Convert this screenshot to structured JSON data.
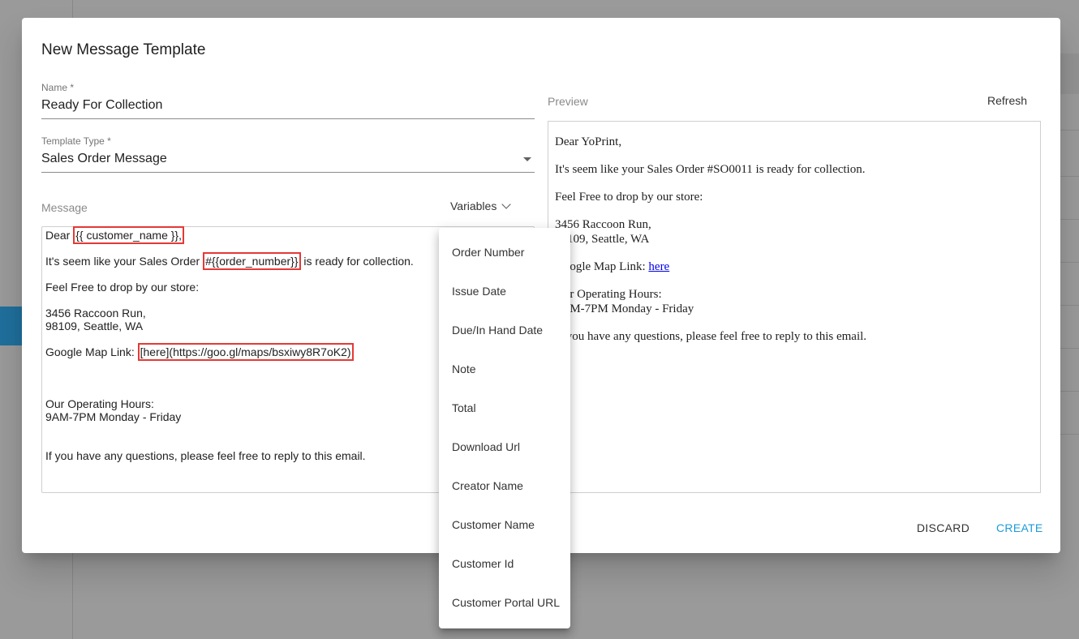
{
  "dialog": {
    "title": "New Message Template"
  },
  "name_field": {
    "label": "Name *",
    "value": "Ready For Collection"
  },
  "template_type_field": {
    "label": "Template Type *",
    "value": "Sales Order Message"
  },
  "message": {
    "label": "Message",
    "variables_label": "Variables",
    "lines": {
      "l1_pre": "Dear ",
      "l1_var": "{{ customer_name }},",
      "l2_pre": "It's seem like your Sales Order ",
      "l2_var": "#{{order_number}}",
      "l2_post": " is ready for collection.",
      "l3": "Feel Free to drop by our store:",
      "l4": "3456 Raccoon Run,",
      "l5": "98109, Seattle, WA",
      "l6_pre": "Google Map Link: ",
      "l6_var": "[here](https://goo.gl/maps/bsxiwy8R7oK2)",
      "l7": "Our Operating Hours:",
      "l8": "9AM-7PM Monday - Friday",
      "l9": "If you have any questions, please feel free to reply to this email."
    }
  },
  "preview": {
    "label": "Preview",
    "refresh_label": "Refresh",
    "lines": {
      "p1": "Dear YoPrint,",
      "p2": "It's seem like your Sales Order #SO0011 is ready for collection.",
      "p3": "Feel Free to drop by our store:",
      "p4": "3456 Raccoon Run,",
      "p5": "98109, Seattle, WA",
      "p6_pre": "Google Map Link: ",
      "p6_link": "here",
      "p7": "Our Operating Hours:",
      "p8": "9AM-7PM Monday - Friday",
      "p9": "If you have any questions, please feel free to reply to this email."
    }
  },
  "actions": {
    "discard": "DISCARD",
    "create": "CREATE"
  },
  "variables_menu": {
    "items": [
      "Order Number",
      "Issue Date",
      "Due/In Hand Date",
      "Note",
      "Total",
      "Download Url",
      "Creator Name",
      "Customer Name",
      "Customer Id",
      "Customer Portal URL"
    ]
  },
  "colors": {
    "accent": "#1e9bd7",
    "highlight_border": "#e53935",
    "link": "#0000ee"
  }
}
